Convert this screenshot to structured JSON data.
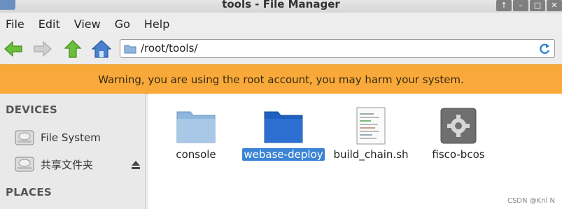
{
  "window": {
    "title": "tools - File Manager",
    "controls": [
      "↑",
      "–",
      "□",
      "✕"
    ]
  },
  "menu": {
    "items": [
      "File",
      "Edit",
      "View",
      "Go",
      "Help"
    ]
  },
  "toolbar": {
    "back_icon": "back-arrow-icon",
    "forward_icon": "forward-arrow-icon",
    "up_icon": "up-arrow-icon",
    "home_icon": "home-icon"
  },
  "address": {
    "path": "/root/tools/"
  },
  "warning": {
    "text": "Warning, you are using the root account, you may harm your system."
  },
  "sidebar": {
    "devices_header": "DEVICES",
    "devices": [
      {
        "label": "File System"
      },
      {
        "label": "共享文件夹"
      }
    ],
    "places_header": "PLACES"
  },
  "files": [
    {
      "name": "console",
      "kind": "folder",
      "selected": false
    },
    {
      "name": "webase-deploy",
      "kind": "folder",
      "selected": true
    },
    {
      "name": "build_chain.sh",
      "kind": "script",
      "selected": false
    },
    {
      "name": "fisco-bcos",
      "kind": "executable",
      "selected": false
    }
  ],
  "watermark": "CSDN @Knl N",
  "colors": {
    "warning_bg": "#f8a93a",
    "selection": "#3b83d4",
    "folder": "#8fb7dd",
    "folder_selected": "#1f5fbf"
  }
}
